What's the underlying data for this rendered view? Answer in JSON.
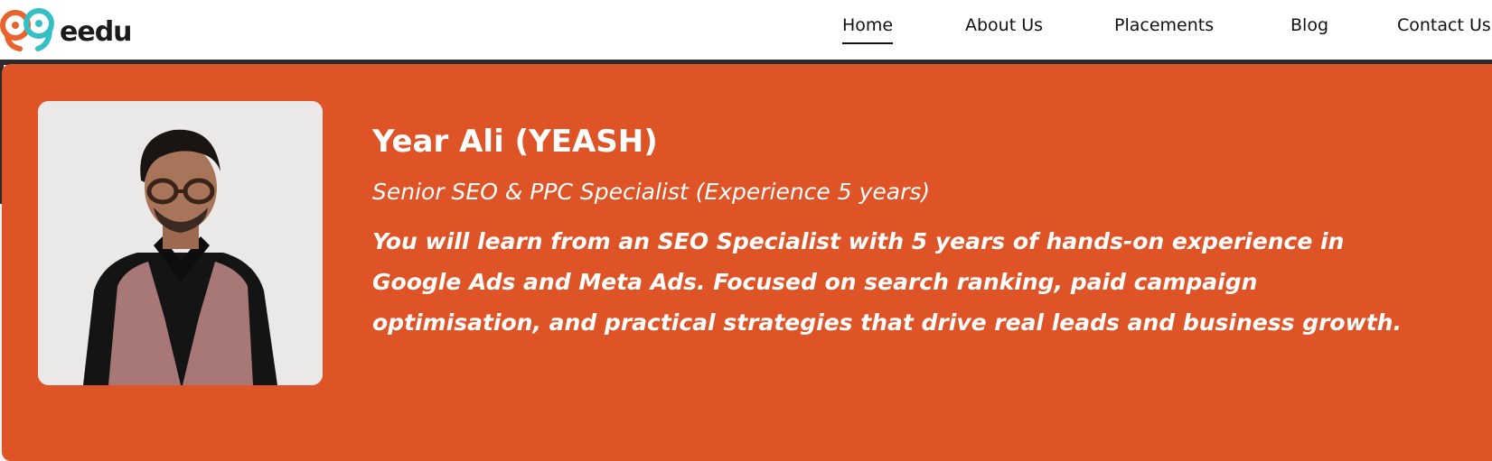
{
  "brand": {
    "logo_text": "eedu",
    "colors": {
      "orange": "#e8642c",
      "teal": "#33bfc4",
      "dark": "#1b1b1b"
    }
  },
  "nav": {
    "items": [
      {
        "label": "Home",
        "active": true
      },
      {
        "label": "About Us",
        "active": false
      },
      {
        "label": "Placements",
        "active": false
      },
      {
        "label": "Blog",
        "active": false
      },
      {
        "label": "Contact Us",
        "active": false
      }
    ]
  },
  "instructor": {
    "photo_alt": "instructor-photo",
    "name": "Year Ali (YEASH)",
    "role": "Senior SEO & PPC Specialist (Experience 5 years)",
    "bio": "You will learn from an SEO Specialist with 5 years of hands-on experience in Google Ads and Meta Ads. Focused on search ranking, paid campaign optimisation, and practical strategies that drive real leads and business growth."
  },
  "theme": {
    "card_background": "#de5426",
    "text_color": "#ffffff"
  }
}
